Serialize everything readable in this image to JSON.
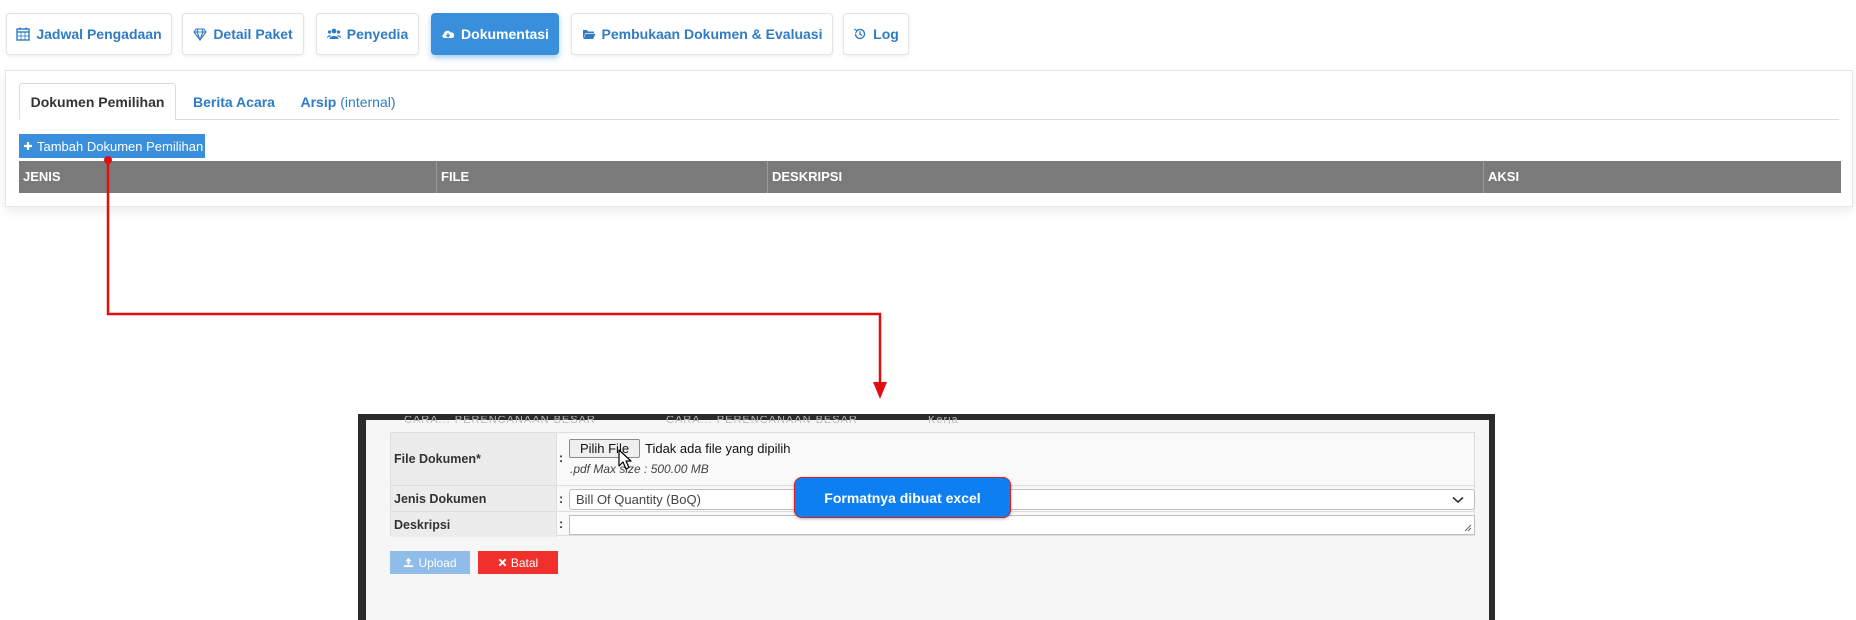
{
  "nav": {
    "items": [
      {
        "label": "Jadwal Pengadaan",
        "icon": "calendar-icon"
      },
      {
        "label": "Detail Paket",
        "icon": "diamond-icon"
      },
      {
        "label": "Penyedia",
        "icon": "users-icon"
      },
      {
        "label": "Dokumentasi",
        "icon": "cloud-download-icon",
        "active": true
      },
      {
        "label": "Pembukaan Dokumen & Evaluasi",
        "icon": "folder-open-icon"
      },
      {
        "label": "Log",
        "icon": "history-icon"
      }
    ]
  },
  "tabs": {
    "items": [
      {
        "label": "Dokumen Pemilihan",
        "active": true
      },
      {
        "label": "Berita Acara"
      },
      {
        "label": "Arsip",
        "suffix": "(internal)"
      }
    ]
  },
  "actions": {
    "add_label": "Tambah Dokumen Pemilihan"
  },
  "table": {
    "columns": [
      "JENIS",
      "FILE",
      "DESKRIPSI",
      "AKSI"
    ]
  },
  "modal": {
    "ghost_text": [
      "CARA... PERENCANAAN BESAR",
      "CARA... PERENCANAAN BESAR",
      "Kerja"
    ],
    "file_label": "File Dokumen*",
    "colon": ":",
    "file_button": "Pilih File",
    "file_status": "Tidak ada file yang dipilih",
    "file_hint": ".pdf Max size : 500.00 MB",
    "jenis_label": "Jenis Dokumen",
    "jenis_value": "Bill Of Quantity (BoQ)",
    "deskripsi_label": "Deskripsi",
    "upload_label": "Upload",
    "batal_label": "Batal"
  },
  "callout": {
    "text": "Formatnya dibuat excel"
  },
  "colors": {
    "primary": "#3a8fdc",
    "link": "#2f7cc4",
    "header_gray": "#7a7a7a",
    "danger": "#f0312b",
    "arrow": "#e01010",
    "callout": "#0d7ff0"
  }
}
